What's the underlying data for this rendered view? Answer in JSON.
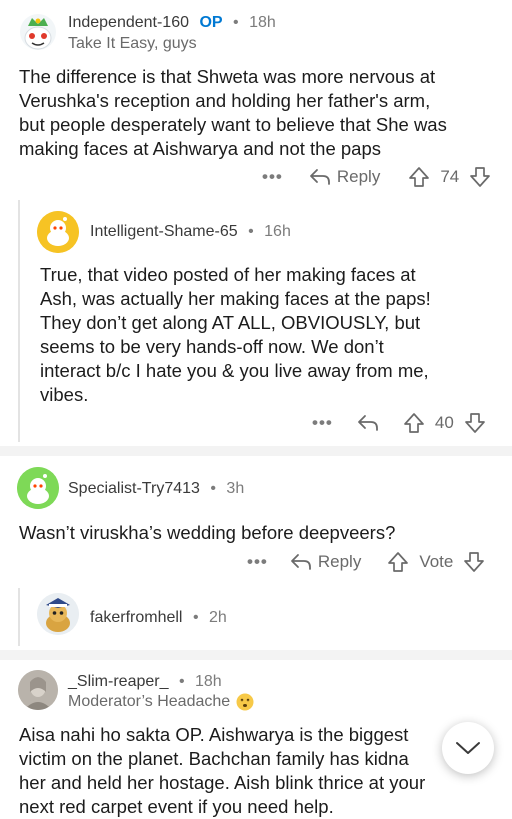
{
  "comments": [
    {
      "username": "Independent-160",
      "op_badge": "OP",
      "time": "18h",
      "flair": "Take It Easy, guys",
      "body": [
        "The difference is that Shweta was more nervous at",
        "Verushka's reception and holding her father's arm,",
        "but people desperately want to believe that She was",
        "making faces at Aishwarya and not the paps"
      ],
      "reply_label": "Reply",
      "votes": "74"
    },
    {
      "username": "Intelligent-Shame-65",
      "time": "16h",
      "body": [
        "True, that video posted of her making faces at",
        "Ash, was actually her making faces at the paps!",
        "They don’t get along AT ALL, OBVIOUSLY, but",
        "seems to be very hands-off now. We don’t",
        "interact b/c I hate you & you live away from me,",
        "vibes."
      ],
      "votes": "40"
    },
    {
      "username": "Specialist-Try7413",
      "time": "3h",
      "body": [
        "Wasn’t viruskha’s wedding before deepveers?"
      ],
      "reply_label": "Reply",
      "votes": "Vote"
    },
    {
      "username": "fakerfromhell",
      "time": "2h"
    },
    {
      "username": "_Slim-reaper_",
      "time": "18h",
      "flair": "Moderator’s Headache",
      "body": [
        "Aisa nahi ho sakta OP. Aishwarya is the biggest",
        "victim on the planet. Bachchan family has kidna",
        "her and held her hostage. Aish blink thrice at your",
        "next red carpet event if you need help."
      ]
    }
  ],
  "more_glyph": "•••",
  "dot_glyph": "•",
  "colors": {
    "op": "#0079d3",
    "meta": "#7c7c7c",
    "separator": "#f3f3f3"
  }
}
